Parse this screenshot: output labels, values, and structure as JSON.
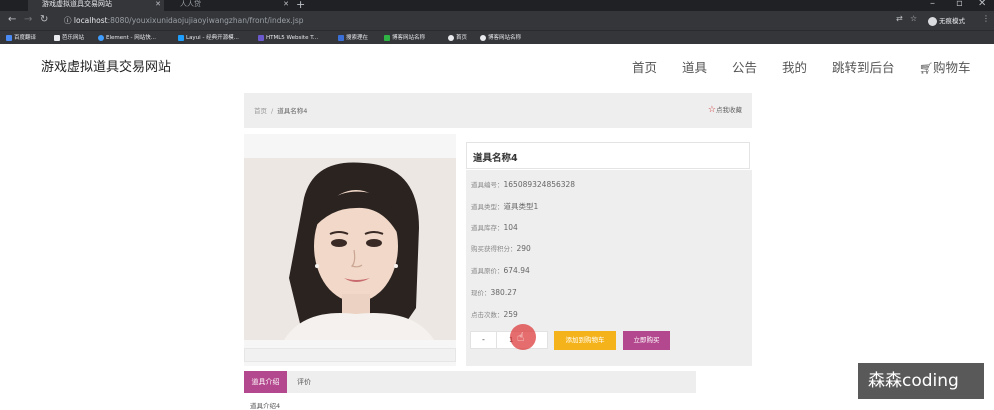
{
  "browser": {
    "tabs": [
      {
        "title": "游戏虚拟道具交易网站",
        "active": true
      },
      {
        "title": "人人贷",
        "active": false
      }
    ],
    "url_host": "localhost",
    "url_path": ":8080/youxixunidaojujiaoyiwangzhan/front/index.jsp",
    "profile_label": "无痕模式",
    "bookmarks": [
      "百度翻译",
      "芭乐网站",
      "Element - 网站快...",
      "Layui - 经典开源模...",
      "HTML5 Website T...",
      "搜索理在",
      "博客网站名称",
      "首页",
      "博客网站名称"
    ]
  },
  "header": {
    "site_title": "游戏虚拟道具交易网站",
    "nav": [
      "首页",
      "道具",
      "公告",
      "我的",
      "跳转到后台",
      "购物车"
    ]
  },
  "breadcrumb": {
    "home": "首页",
    "separator": "/",
    "current": "道具名称4",
    "favorite": "点我收藏"
  },
  "item": {
    "name": "道具名称4",
    "fields": [
      {
        "label": "道具编号：",
        "value": "165089324856328"
      },
      {
        "label": "道具类型：",
        "value": "道具类型1"
      },
      {
        "label": "道具库存：",
        "value": "104"
      },
      {
        "label": "购买获得积分：",
        "value": "290"
      },
      {
        "label": "道具原价：",
        "value": "674.94"
      },
      {
        "label": "现价：",
        "value": "380.27"
      },
      {
        "label": "点击次数：",
        "value": "259"
      }
    ],
    "quantity": "1",
    "minus": "-",
    "add_to_cart": "添加到购物车",
    "buy_now": "立即购买"
  },
  "tabs": {
    "intro": "道具介绍",
    "review": "评价",
    "intro_text": "道具介绍4"
  },
  "watermark": "森森coding",
  "colors": {
    "accent": "#b4488e",
    "cart": "#f5b31b",
    "chrome_dark": "#35363a"
  }
}
